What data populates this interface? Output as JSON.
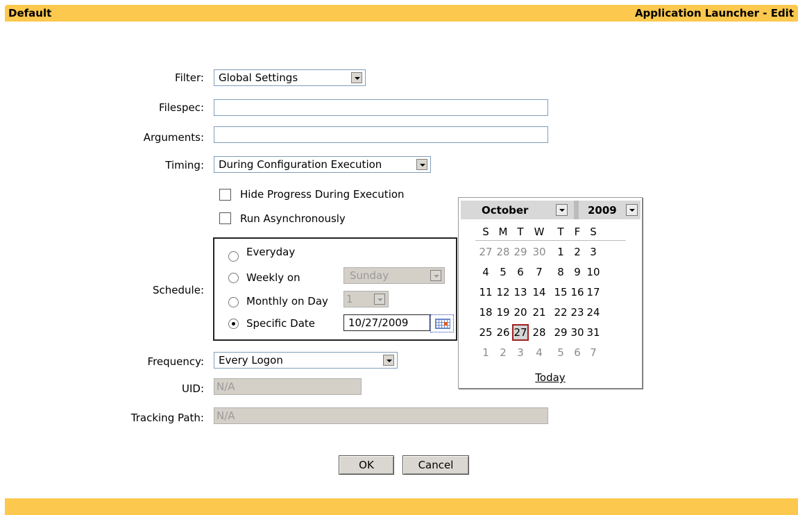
{
  "header": {
    "left": "Default",
    "right": "Application Launcher - Edit"
  },
  "form": {
    "filter": {
      "label": "Filter:",
      "value": "Global Settings"
    },
    "filespec": {
      "label": "Filespec:",
      "value": ""
    },
    "arguments": {
      "label": "Arguments:",
      "value": ""
    },
    "timing": {
      "label": "Timing:",
      "value": "During Configuration Execution"
    },
    "hide_progress": {
      "label": "Hide Progress During Execution",
      "checked": false
    },
    "run_async": {
      "label": "Run Asynchronously",
      "checked": false
    },
    "schedule": {
      "label": "Schedule:",
      "everyday": "Everyday",
      "weekly": "Weekly on",
      "weekly_value": "Sunday",
      "monthly": "Monthly on Day",
      "monthly_value": "1",
      "specific": "Specific Date",
      "specific_value": "10/27/2009",
      "selected": "specific"
    },
    "frequency": {
      "label": "Frequency:",
      "value": "Every Logon"
    },
    "uid": {
      "label": "UID:",
      "value": "N/A"
    },
    "tracking": {
      "label": "Tracking Path:",
      "value": "N/A"
    }
  },
  "buttons": {
    "ok": "OK",
    "cancel": "Cancel"
  },
  "calendar": {
    "month": "October",
    "year": "2009",
    "dow": [
      "S",
      "M",
      "T",
      "W",
      "T",
      "F",
      "S"
    ],
    "weeks": [
      [
        "27",
        "28",
        "29",
        "30",
        "1",
        "2",
        "3"
      ],
      [
        "4",
        "5",
        "6",
        "7",
        "8",
        "9",
        "10"
      ],
      [
        "11",
        "12",
        "13",
        "14",
        "15",
        "16",
        "17"
      ],
      [
        "18",
        "19",
        "20",
        "21",
        "22",
        "23",
        "24"
      ],
      [
        "25",
        "26",
        "27",
        "28",
        "29",
        "30",
        "31"
      ],
      [
        "1",
        "2",
        "3",
        "4",
        "5",
        "6",
        "7"
      ]
    ],
    "selected_day": "27",
    "today": "Today"
  },
  "colors": {
    "bar": "#fcc84d",
    "selected_day_border": "#a02020"
  }
}
